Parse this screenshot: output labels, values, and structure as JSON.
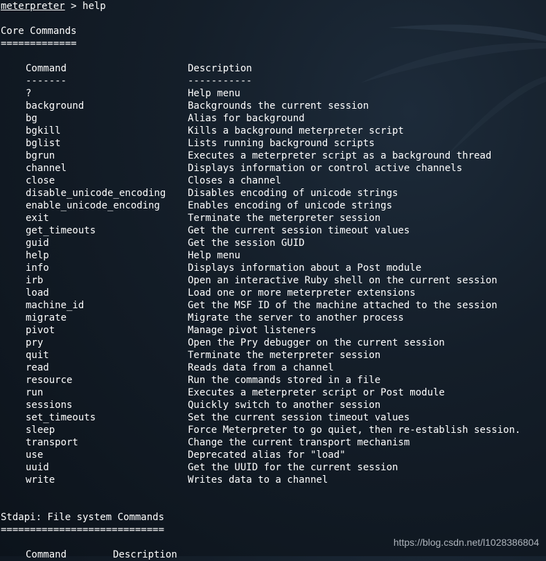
{
  "prompt": {
    "name": "meterpreter",
    "separator": " > ",
    "command": "help"
  },
  "core": {
    "title": "Core Commands",
    "underline": "=============",
    "header_cmd": "Command",
    "header_desc": "Description",
    "sep_cmd": "-------",
    "sep_desc": "-----------",
    "rows": [
      {
        "cmd": "?",
        "desc": "Help menu"
      },
      {
        "cmd": "background",
        "desc": "Backgrounds the current session"
      },
      {
        "cmd": "bg",
        "desc": "Alias for background"
      },
      {
        "cmd": "bgkill",
        "desc": "Kills a background meterpreter script"
      },
      {
        "cmd": "bglist",
        "desc": "Lists running background scripts"
      },
      {
        "cmd": "bgrun",
        "desc": "Executes a meterpreter script as a background thread"
      },
      {
        "cmd": "channel",
        "desc": "Displays information or control active channels"
      },
      {
        "cmd": "close",
        "desc": "Closes a channel"
      },
      {
        "cmd": "disable_unicode_encoding",
        "desc": "Disables encoding of unicode strings"
      },
      {
        "cmd": "enable_unicode_encoding",
        "desc": "Enables encoding of unicode strings"
      },
      {
        "cmd": "exit",
        "desc": "Terminate the meterpreter session"
      },
      {
        "cmd": "get_timeouts",
        "desc": "Get the current session timeout values"
      },
      {
        "cmd": "guid",
        "desc": "Get the session GUID"
      },
      {
        "cmd": "help",
        "desc": "Help menu"
      },
      {
        "cmd": "info",
        "desc": "Displays information about a Post module"
      },
      {
        "cmd": "irb",
        "desc": "Open an interactive Ruby shell on the current session"
      },
      {
        "cmd": "load",
        "desc": "Load one or more meterpreter extensions"
      },
      {
        "cmd": "machine_id",
        "desc": "Get the MSF ID of the machine attached to the session"
      },
      {
        "cmd": "migrate",
        "desc": "Migrate the server to another process"
      },
      {
        "cmd": "pivot",
        "desc": "Manage pivot listeners"
      },
      {
        "cmd": "pry",
        "desc": "Open the Pry debugger on the current session"
      },
      {
        "cmd": "quit",
        "desc": "Terminate the meterpreter session"
      },
      {
        "cmd": "read",
        "desc": "Reads data from a channel"
      },
      {
        "cmd": "resource",
        "desc": "Run the commands stored in a file"
      },
      {
        "cmd": "run",
        "desc": "Executes a meterpreter script or Post module"
      },
      {
        "cmd": "sessions",
        "desc": "Quickly switch to another session"
      },
      {
        "cmd": "set_timeouts",
        "desc": "Set the current session timeout values"
      },
      {
        "cmd": "sleep",
        "desc": "Force Meterpreter to go quiet, then re-establish session."
      },
      {
        "cmd": "transport",
        "desc": "Change the current transport mechanism"
      },
      {
        "cmd": "use",
        "desc": "Deprecated alias for \"load\""
      },
      {
        "cmd": "uuid",
        "desc": "Get the UUID for the current session"
      },
      {
        "cmd": "write",
        "desc": "Writes data to a channel"
      }
    ]
  },
  "stdapi_fs": {
    "title": "Stdapi: File system Commands",
    "underline": "============================",
    "header_cmd": "Command",
    "header_desc": "Description"
  },
  "watermark": "https://blog.csdn.net/l1028386804",
  "colors": {
    "background": "#141e29",
    "text": "#ffffff",
    "watermark": "#c9cfd6"
  }
}
